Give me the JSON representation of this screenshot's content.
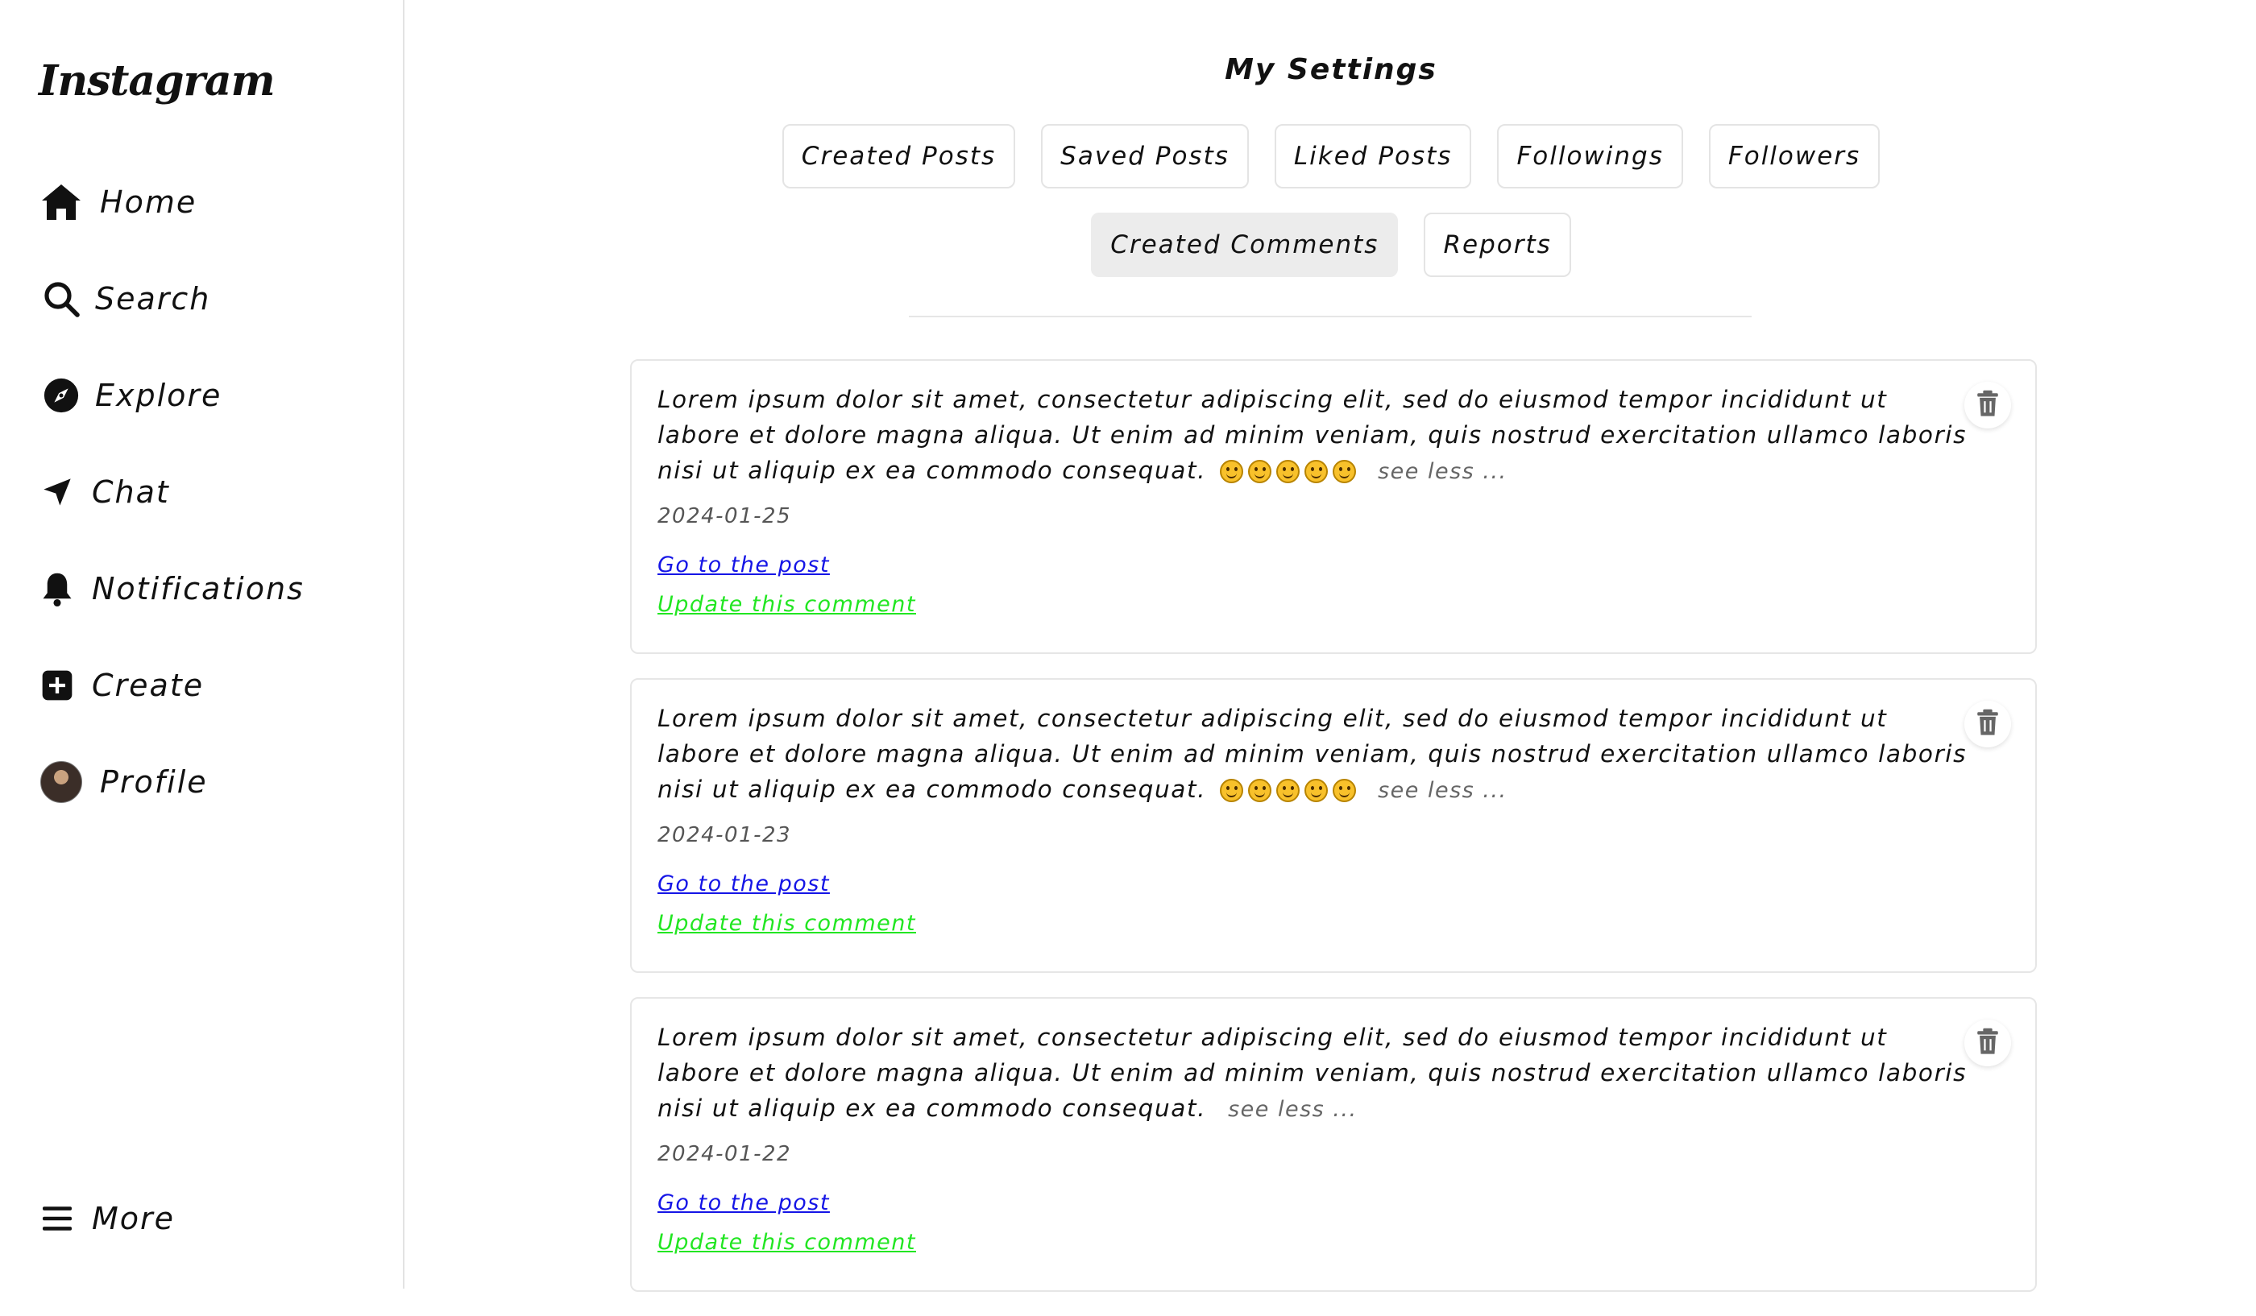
{
  "sidebar": {
    "logo": "Instagram",
    "items": [
      {
        "label": "Home",
        "icon": "home-icon"
      },
      {
        "label": "Search",
        "icon": "search-icon"
      },
      {
        "label": "Explore",
        "icon": "compass-icon"
      },
      {
        "label": "Chat",
        "icon": "send-icon"
      },
      {
        "label": "Notifications",
        "icon": "bell-icon"
      },
      {
        "label": "Create",
        "icon": "plus-square-icon"
      },
      {
        "label": "Profile",
        "icon": "avatar"
      }
    ],
    "more": {
      "label": "More",
      "icon": "menu-icon"
    }
  },
  "main": {
    "title": "My Settings",
    "tabs": [
      {
        "label": "Created Posts"
      },
      {
        "label": "Saved Posts"
      },
      {
        "label": "Liked Posts"
      },
      {
        "label": "Followings"
      },
      {
        "label": "Followers"
      },
      {
        "label": "Created Comments",
        "active": true
      },
      {
        "label": "Reports"
      }
    ],
    "comments": [
      {
        "text": "Lorem ipsum dolor sit amet, consectetur adipiscing elit, sed do eiusmod tempor incididunt ut labore et dolore magna aliqua. Ut enim ad minim veniam, quis nostrud exercitation ullamco laboris nisi ut aliquip ex ea commodo consequat.",
        "emoji_count": 5,
        "see_less": "see less ...",
        "date": "2024-01-25",
        "go_to_post": "Go to the post",
        "update": "Update this comment"
      },
      {
        "text": "Lorem ipsum dolor sit amet, consectetur adipiscing elit, sed do eiusmod tempor incididunt ut labore et dolore magna aliqua. Ut enim ad minim veniam, quis nostrud exercitation ullamco laboris nisi ut aliquip ex ea commodo consequat.",
        "emoji_count": 5,
        "see_less": "see less ...",
        "date": "2024-01-23",
        "go_to_post": "Go to the post",
        "update": "Update this comment"
      },
      {
        "text": "Lorem ipsum dolor sit amet, consectetur adipiscing elit, sed do eiusmod tempor incididunt ut labore et dolore magna aliqua. Ut enim ad minim veniam, quis nostrud exercitation ullamco laboris nisi ut aliquip ex ea commodo consequat.",
        "emoji_count": 0,
        "see_less": "see less ...",
        "date": "2024-01-22",
        "go_to_post": "Go to the post",
        "update": "Update this comment"
      }
    ]
  },
  "colors": {
    "link_blue": "#1515e6",
    "link_green": "#22e622",
    "active_tab_bg": "#ececec"
  }
}
